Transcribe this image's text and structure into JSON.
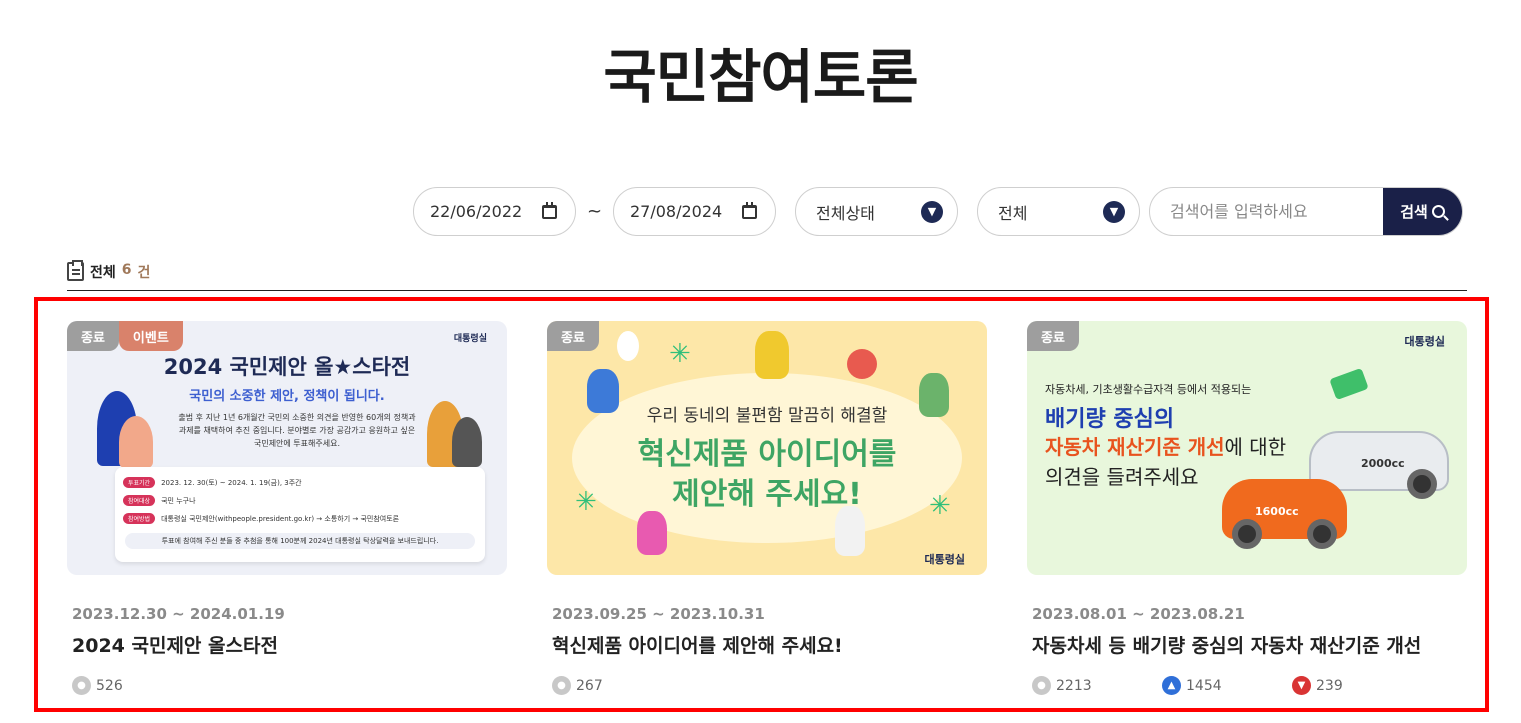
{
  "page": {
    "title": "국민참여토론"
  },
  "filters": {
    "start_date": "22/06/2022",
    "separator": "~",
    "end_date": "27/08/2024",
    "status_select": "전체상태",
    "category_select": "전체",
    "search_placeholder": "검색어를 입력하세요",
    "search_button": "검색"
  },
  "summary": {
    "label": "전체",
    "count": "6",
    "unit": "건"
  },
  "cards": [
    {
      "badges": [
        "종료",
        "이벤트"
      ],
      "date_range": "2023.12.30 ~ 2024.01.19",
      "title": "2024 국민제안 올스타전",
      "comments": "526",
      "thumb": {
        "logo": "대통령실",
        "headline": "2024 국민제안 올★스타전",
        "subhead": "국민의 소중한 제안, 정책이 됩니다.",
        "desc": "출범 후 지난 1년 6개월간 국민의 소중한 의견을 반영한 60개의 정책과 과제를 채택하여 추진 중입니다. 분야별로 가장 공감가고 응원하고 싶은 국민제안에 투표해주세요.",
        "rows": [
          {
            "tag": "투표기간",
            "text": "2023. 12. 30(토) ~ 2024. 1. 19(금), 3주간"
          },
          {
            "tag": "참여대상",
            "text": "국민 누구나"
          },
          {
            "tag": "참여방법",
            "text": "대통령실 국민제안(withpeople.president.go.kr) → 소통하기 → 국민참여토론"
          }
        ],
        "note": "투표에 참여해 주신 분들 중 추첨을 통해 100분께 2024년 대통령실 탁상달력을 보내드립니다."
      }
    },
    {
      "badges": [
        "종료"
      ],
      "date_range": "2023.09.25 ~ 2023.10.31",
      "title": "혁신제품 아이디어를 제안해 주세요!",
      "comments": "267",
      "thumb": {
        "subhead": "우리 동네의 불편함 말끔히 해결할",
        "headline_1": "혁신제품 아이디어를",
        "headline_2": "제안해 주세요!",
        "logo": "대통령실"
      }
    },
    {
      "badges": [
        "종료"
      ],
      "date_range": "2023.08.01 ~ 2023.08.21",
      "title": "자동차세 등 배기량 중심의 자동차 재산기준 개선",
      "comments": "2213",
      "likes": "1454",
      "dislikes": "239",
      "thumb": {
        "logo": "대통령실",
        "subhead": "자동차세, 기초생활수급자격 등에서 적용되는",
        "headline_1": "배기량 중심의",
        "headline_2_strong": "자동차 재산기준 개선",
        "headline_2_rest": "에 대한",
        "headline_3": "의견을 들려주세요",
        "car_small": "1600cc",
        "car_large": "2000cc"
      }
    }
  ],
  "colors": {
    "navy": "#1a2048",
    "highlight": "#ff0000",
    "badge_gray": "#9e9e9e",
    "badge_event": "#d9826b",
    "count": "#a0795a"
  },
  "icons": {
    "calendar": "calendar-icon",
    "chevron": "chevron-down-icon",
    "search": "search-icon",
    "list": "clipboard-icon",
    "comment": "comment-icon",
    "like": "thumbs-up-icon",
    "dislike": "thumbs-down-icon"
  }
}
